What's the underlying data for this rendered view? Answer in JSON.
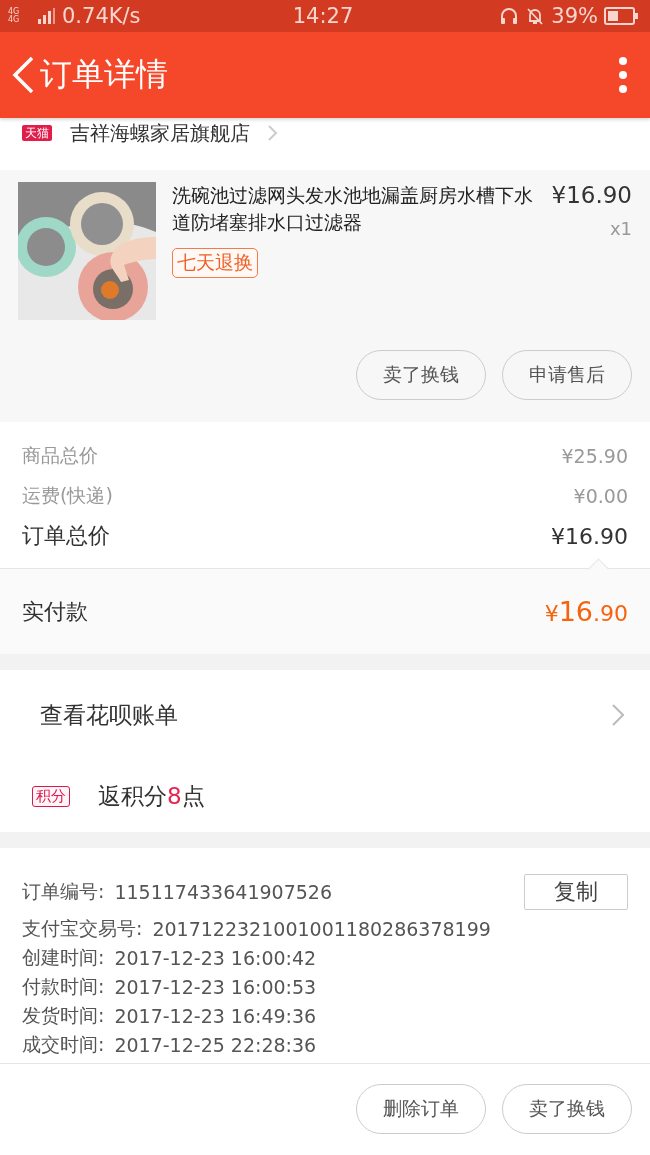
{
  "status_bar": {
    "network": "4G 4G",
    "speed": "0.74K/s",
    "time": "14:27",
    "battery": "39%"
  },
  "header": {
    "title": "订单详情"
  },
  "store": {
    "badge": "天猫",
    "name": "吉祥海螺家居旗舰店"
  },
  "item": {
    "kind": "picture",
    "title": "洗碗池过滤网头发水池地漏盖厨房水槽下水道防堵塞排水口过滤器",
    "tag": "七天退换",
    "price": "¥16.90",
    "quantity": "x1",
    "buttons": [
      "卖了换钱",
      "申请售后"
    ]
  },
  "totals": [
    {
      "kind": "minor",
      "label": "商品总价",
      "value": "¥25.90"
    },
    {
      "kind": "minor",
      "label": "运费(快递)",
      "value": "¥0.00"
    },
    {
      "kind": "major",
      "label": "订单总价",
      "value": "¥16.90"
    }
  ],
  "paid": {
    "label": "实付款",
    "currency": "¥",
    "integer": "16",
    "decimal": ".90"
  },
  "huabei": {
    "label": "查看花呗账单"
  },
  "points": {
    "badge": "积分",
    "prefix": "返积分",
    "amount": "8",
    "suffix": "点"
  },
  "info": [
    {
      "label": "订单编号:",
      "value": "115117433641907526"
    },
    {
      "label": "支付宝交易号:",
      "value": "2017122321001001180286378199"
    },
    {
      "label": "创建时间:",
      "value": "2017-12-23 16:00:42"
    },
    {
      "label": "付款时间:",
      "value": "2017-12-23 16:00:53"
    },
    {
      "label": "发货时间:",
      "value": "2017-12-23 16:49:36"
    },
    {
      "label": "成交时间:",
      "value": "2017-12-25 22:28:36"
    }
  ],
  "copy_button": "复制",
  "footer_buttons": [
    "删除订单",
    "卖了换钱"
  ]
}
